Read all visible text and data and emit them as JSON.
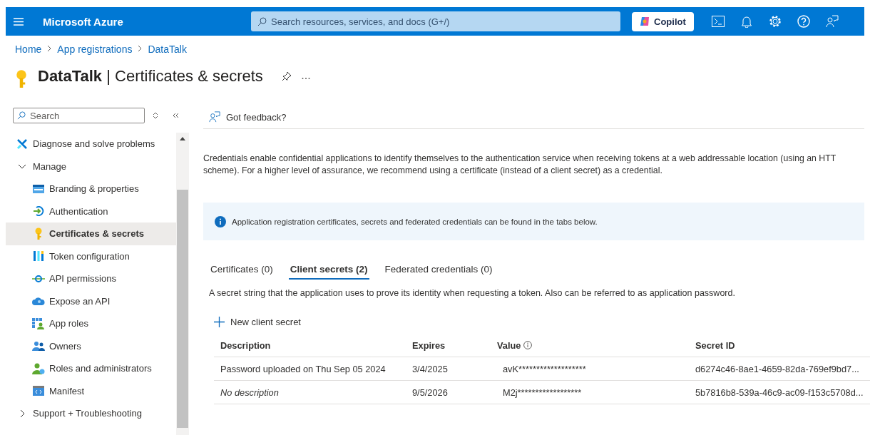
{
  "topbar": {
    "brand": "Microsoft Azure",
    "search": {
      "placeholder": "Search resources, services, and docs (G+/)"
    },
    "copilot": "Copilot"
  },
  "breadcrumb": [
    "Home",
    "App registrations",
    "DataTalk"
  ],
  "page_title": "**DataTalk** | Certificates & secrets",
  "sidebar": {
    "search": {
      "placeholder": "Search"
    },
    "items": [
      {
        "label": "Diagnose and solve problems",
        "kind": "wrench",
        "selected": false
      },
      {
        "label": "Manage",
        "kind": "group",
        "expanded": true,
        "children": [
          {
            "label": "Branding & properties",
            "kind": "branding",
            "selected": false
          },
          {
            "label": "Authentication",
            "kind": "auth",
            "selected": false
          },
          {
            "label": "Certificates & secrets",
            "kind": "key",
            "selected": true
          },
          {
            "label": "Token configuration",
            "kind": "token",
            "selected": false
          },
          {
            "label": "API permissions",
            "kind": "api",
            "selected": false
          },
          {
            "label": "Expose an API",
            "kind": "cloud",
            "selected": false
          },
          {
            "label": "App roles",
            "kind": "roles",
            "selected": false
          },
          {
            "label": "Owners",
            "kind": "owners",
            "selected": false
          },
          {
            "label": "Roles and administrators",
            "kind": "admin",
            "selected": false
          },
          {
            "label": "Manifest",
            "kind": "manifest",
            "selected": false
          }
        ]
      },
      {
        "label": "Support + Troubleshooting",
        "kind": "group",
        "expanded": false
      }
    ]
  },
  "main": {
    "feedback": "Got feedback?",
    "intro": "Credentials enable confidential applications to identify themselves to the authentication service when receiving tokens at a web addressable location (using an HTT\nscheme). For a higher level of assurance, we recommend using a certificate (instead of a client secret) as a credential.",
    "info_banner": "Application registration certificates, secrets and federated credentials can be found in the tabs below.",
    "tabs": [
      {
        "label": "Certificates (0)",
        "selected": false
      },
      {
        "label": "Client secrets (2)",
        "selected": true
      },
      {
        "label": "Federated credentials (0)",
        "selected": false
      }
    ],
    "tab_description": "A secret string that the application uses to prove its identity when requesting a token. Also can be referred to as application password.",
    "new_button": "New client secret",
    "table": {
      "columns": [
        {
          "label": "Description",
          "info": false
        },
        {
          "label": "Expires",
          "info": false
        },
        {
          "label": "Value",
          "info": true
        },
        {
          "label": "Secret ID",
          "info": false
        }
      ],
      "rows": [
        {
          "description": {
            "text": "Password uploaded on Thu Sep 05 2024",
            "kind": "text"
          },
          "expires": "3/4/2025",
          "value": "avK*******************",
          "secret_id": "d6274c46-8ae1-4659-82da-769ef9bd7..."
        },
        {
          "description": {
            "text": "No description",
            "kind": "placeholder"
          },
          "expires": "9/5/2026",
          "value": "M2j******************",
          "secret_id": "5b7816b8-539a-46c9-ac09-f153c5708d..."
        }
      ]
    }
  }
}
